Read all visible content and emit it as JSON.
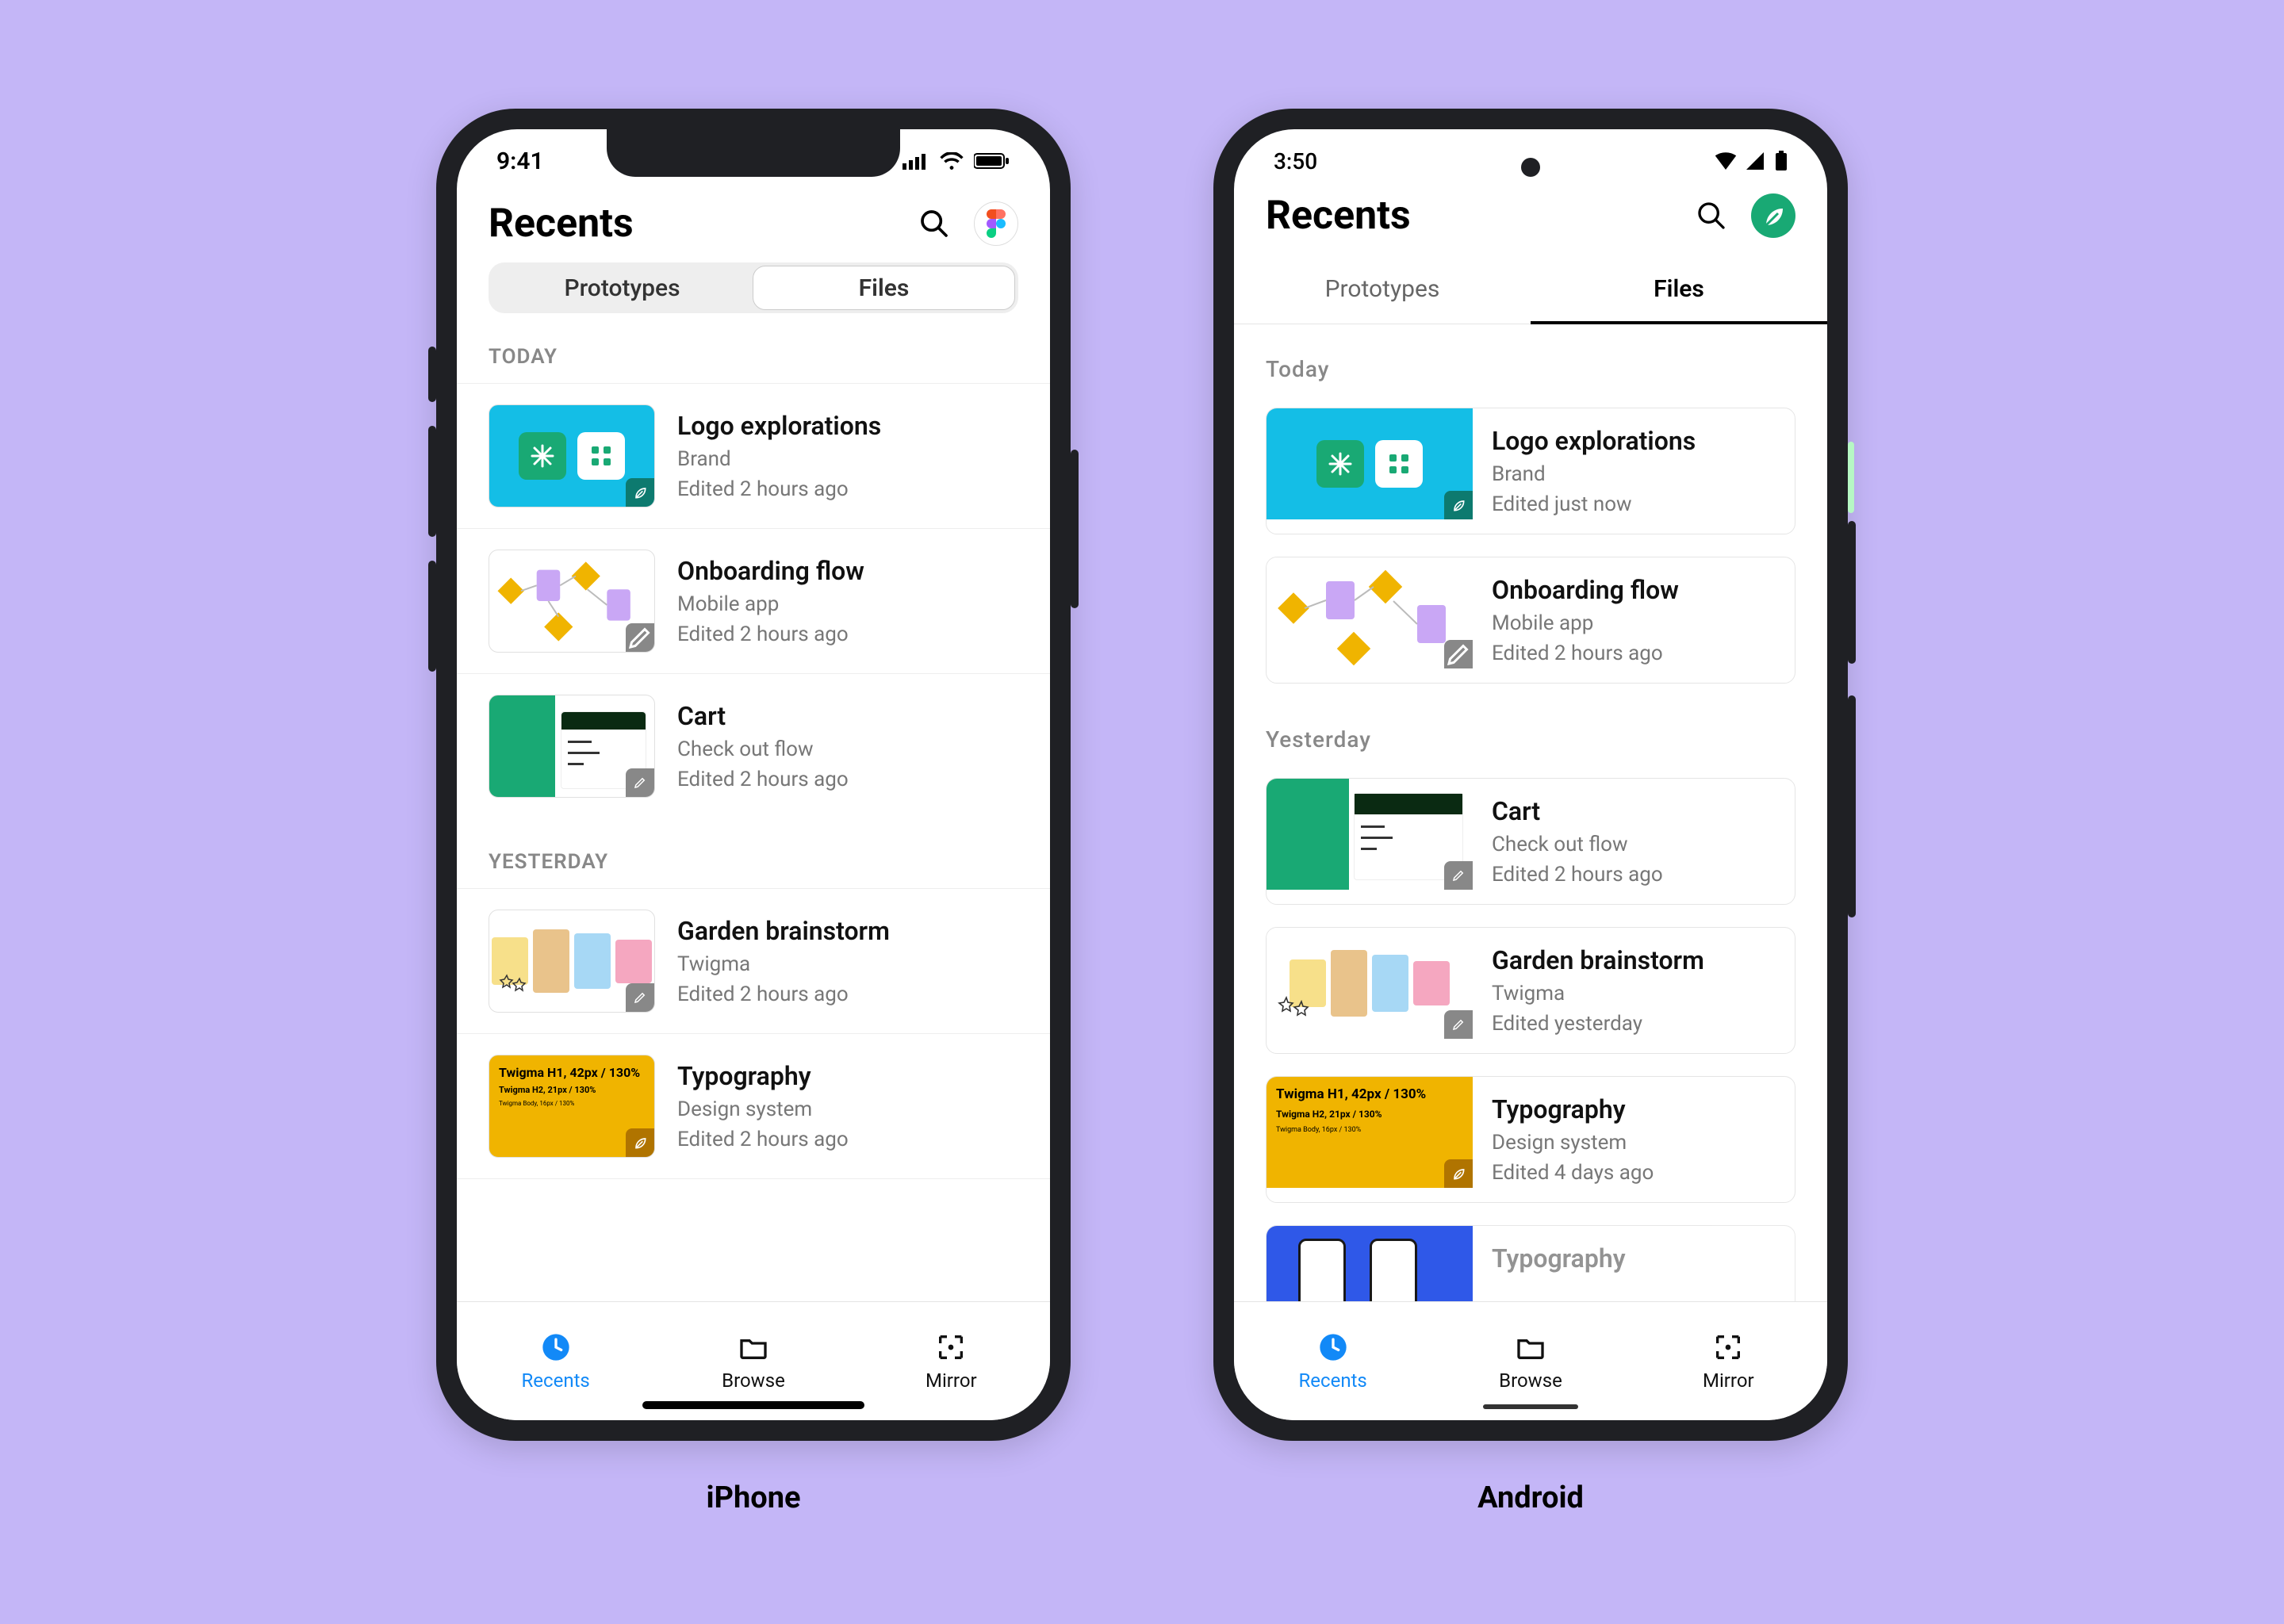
{
  "labels": {
    "iphone": "iPhone",
    "android": "Android"
  },
  "iphone": {
    "status": {
      "time": "9:41"
    },
    "header": {
      "title": "Recents"
    },
    "tabs": {
      "prototypes": "Prototypes",
      "files": "Files"
    },
    "sections": {
      "today": {
        "label": "TODAY",
        "items": [
          {
            "title": "Logo explorations",
            "project": "Brand",
            "edited": "Edited 2 hours ago"
          },
          {
            "title": "Onboarding flow",
            "project": "Mobile app",
            "edited": "Edited 2 hours ago"
          },
          {
            "title": "Cart",
            "project": "Check out flow",
            "edited": "Edited 2 hours ago"
          }
        ]
      },
      "yesterday": {
        "label": "YESTERDAY",
        "items": [
          {
            "title": "Garden brainstorm",
            "project": "Twigma",
            "edited": "Edited 2 hours ago"
          },
          {
            "title": "Typography",
            "project": "Design system",
            "edited": "Edited 2 hours ago"
          }
        ]
      }
    },
    "typo_thumb": {
      "line1": "Twigma H1, 42px / 130%",
      "line2": "Twigma H2, 21px / 130%",
      "line3": "Twigma Body, 16px / 130%"
    },
    "nav": {
      "recents": "Recents",
      "browse": "Browse",
      "mirror": "Mirror"
    }
  },
  "android": {
    "status": {
      "time": "3:50"
    },
    "header": {
      "title": "Recents"
    },
    "tabs": {
      "prototypes": "Prototypes",
      "files": "Files"
    },
    "sections": {
      "today": {
        "label": "Today",
        "items": [
          {
            "title": "Logo explorations",
            "project": "Brand",
            "edited": "Edited just now"
          },
          {
            "title": "Onboarding flow",
            "project": "Mobile app",
            "edited": "Edited 2 hours ago"
          }
        ]
      },
      "yesterday": {
        "label": "Yesterday",
        "items": [
          {
            "title": "Cart",
            "project": "Check out flow",
            "edited": "Edited 2 hours ago"
          },
          {
            "title": "Garden brainstorm",
            "project": "Twigma",
            "edited": "Edited yesterday"
          },
          {
            "title": "Typography",
            "project": "Design system",
            "edited": "Edited 4 days ago"
          },
          {
            "title": "Typography",
            "project": "",
            "edited": ""
          }
        ]
      }
    },
    "typo_thumb": {
      "line1": "Twigma H1, 42px / 130%",
      "line2": "Twigma H2, 21px / 130%",
      "line3": "Twigma Body, 16px / 130%"
    },
    "nav": {
      "recents": "Recents",
      "browse": "Browse",
      "mirror": "Mirror"
    }
  }
}
